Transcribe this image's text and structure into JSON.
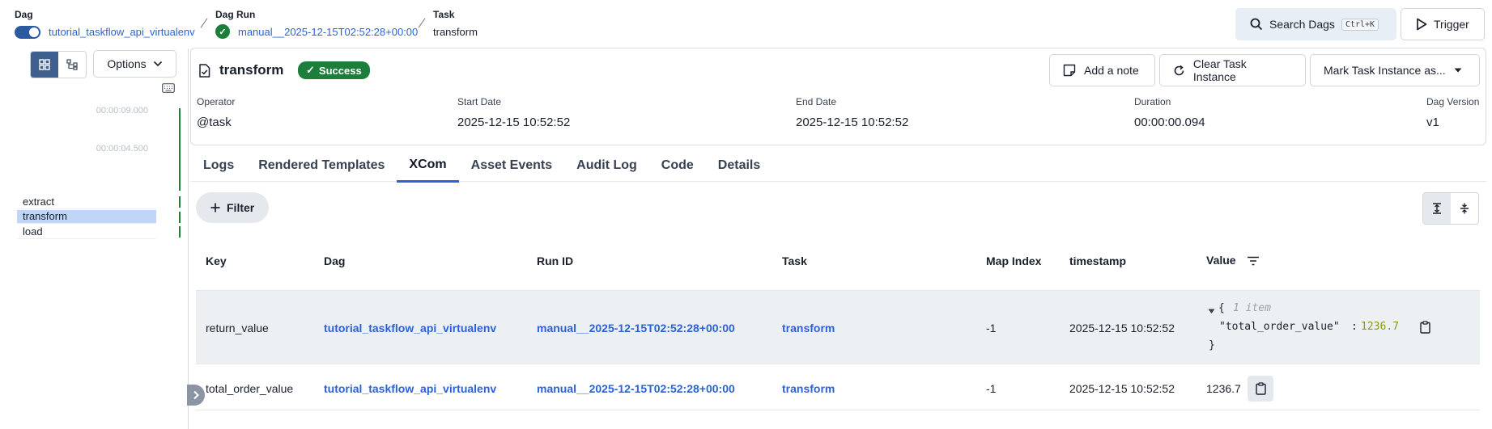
{
  "breadcrumb": {
    "dag_label": "Dag",
    "dag_name": "tutorial_taskflow_api_virtualenv",
    "run_label": "Dag Run",
    "run_id": "manual__2025-12-15T02:52:28+00:00",
    "task_label": "Task",
    "task_name": "transform"
  },
  "topbar": {
    "search_label": "Search Dags",
    "search_shortcut": "Ctrl+K",
    "trigger_label": "Trigger"
  },
  "left_panel": {
    "options_label": "Options",
    "time_labels": [
      "00:00:09.000",
      "00:00:04.500"
    ],
    "tasks": [
      "extract",
      "transform",
      "load"
    ]
  },
  "header": {
    "task_title": "transform",
    "status": "Success",
    "add_note": "Add a note",
    "clear_task": "Clear Task Instance",
    "mark_task": "Mark Task Instance as...",
    "meta": [
      {
        "label": "Operator",
        "value": "@task"
      },
      {
        "label": "Start Date",
        "value": "2025-12-15 10:52:52"
      },
      {
        "label": "End Date",
        "value": "2025-12-15 10:52:52"
      },
      {
        "label": "Duration",
        "value": "00:00:00.094"
      },
      {
        "label": "Dag Version",
        "value": "v1"
      }
    ]
  },
  "tabs": [
    "Logs",
    "Rendered Templates",
    "XCom",
    "Asset Events",
    "Audit Log",
    "Code",
    "Details"
  ],
  "active_tab": "XCom",
  "filter_label": "Filter",
  "table": {
    "columns": [
      "Key",
      "Dag",
      "Run ID",
      "Task",
      "Map Index",
      "timestamp",
      "Value"
    ],
    "rows": [
      {
        "key": "return_value",
        "dag": "tutorial_taskflow_api_virtualenv",
        "run_id": "manual__2025-12-15T02:52:28+00:00",
        "task": "transform",
        "map_index": "-1",
        "timestamp": "2025-12-15 10:52:52",
        "value_open": "{",
        "value_hint": "1 item",
        "value_key": "\"total_order_value\"",
        "value_colon": ":",
        "value_num": "1236.7",
        "value_close": "}"
      },
      {
        "key": "total_order_value",
        "dag": "tutorial_taskflow_api_virtualenv",
        "run_id": "manual__2025-12-15T02:52:28+00:00",
        "task": "transform",
        "map_index": "-1",
        "timestamp": "2025-12-15 10:52:52",
        "value": "1236.7"
      }
    ]
  },
  "colors": {
    "accent": "#2b62d9",
    "success": "#1b7f3b",
    "selected_row": "#bfd6f6"
  }
}
